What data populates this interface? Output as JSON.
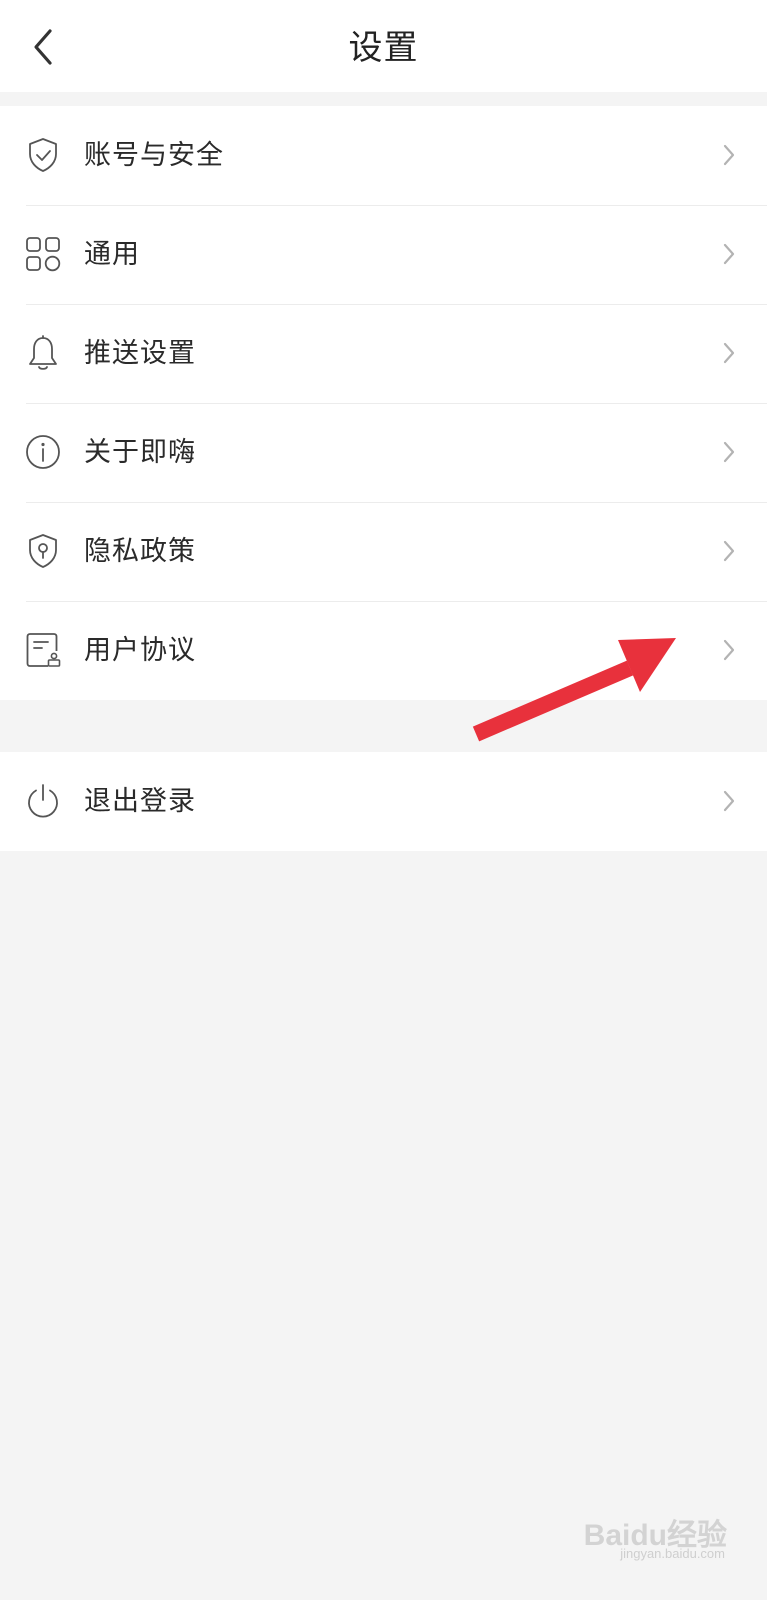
{
  "header": {
    "title": "设置",
    "back_icon": "chevron-left-icon"
  },
  "settings_menu": {
    "items": [
      {
        "label": "账号与安全",
        "icon": "shield-check-icon"
      },
      {
        "label": "通用",
        "icon": "grid-apps-icon"
      },
      {
        "label": "推送设置",
        "icon": "bell-icon"
      },
      {
        "label": "关于即嗨",
        "icon": "info-icon"
      },
      {
        "label": "隐私政策",
        "icon": "shield-lock-icon"
      },
      {
        "label": "用户协议",
        "icon": "document-stamp-icon"
      }
    ]
  },
  "logout": {
    "label": "退出登录",
    "icon": "power-icon"
  },
  "annotation": {
    "arrow_color": "#e8313c",
    "target": "用户协议"
  },
  "watermark": {
    "brand": "Baidu经验",
    "url": "jingyan.baidu.com"
  },
  "colors": {
    "background": "#f4f4f4",
    "surface": "#ffffff",
    "text": "#2a2a2a",
    "icon": "#555555",
    "chevron": "#b3b3b3",
    "divider": "#ececec"
  }
}
